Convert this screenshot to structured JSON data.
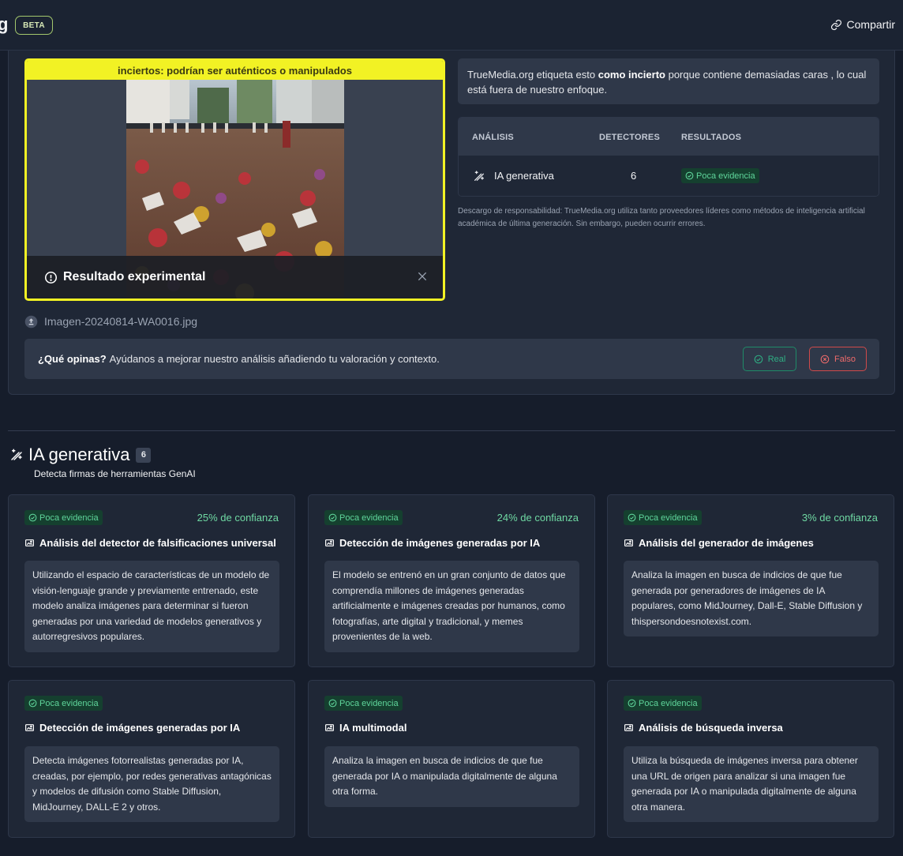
{
  "header": {
    "brand_char": "g",
    "beta": "BETA",
    "share": "Compartir"
  },
  "preview": {
    "banner": "inciertos: podrían ser auténticos o manipulados",
    "overlay_title": "Resultado experimental",
    "filename": "Imagen-20240814-WA0016.jpg"
  },
  "label_box": {
    "part1": "TrueMedia.org etiqueta esto ",
    "bold": "como incierto",
    "part2": " porque contiene demasiadas caras , lo cual está fuera de nuestro enfoque."
  },
  "analysis_table": {
    "headers": [
      "ANÁLISIS",
      "DETECTORES",
      "RESULTADOS"
    ],
    "rows": [
      {
        "name": "IA generativa",
        "detectors": "6",
        "result": "Poca evidencia"
      }
    ]
  },
  "disclaimer": "Descargo de responsabilidad: TrueMedia.org utiliza tanto proveedores líderes como métodos de inteligencia artificial académica de última generación. Sin embargo, pueden ocurrir errores.",
  "feedback": {
    "question": "¿Qué opinas?",
    "text": "Ayúdanos a mejorar nuestro análisis añadiendo tu valoración y contexto.",
    "real": "Real",
    "fake": "Falso"
  },
  "section": {
    "title": "IA generativa",
    "count": "6",
    "subtitle": "Detecta firmas de herramientas GenAI"
  },
  "detectors": [
    {
      "badge": "Poca evidencia",
      "confidence": "25% de confianza",
      "title": "Análisis del detector de falsificaciones universal",
      "desc": "Utilizando el espacio de características de un modelo de visión-lenguaje grande y previamente entrenado, este modelo analiza imágenes para determinar si fueron generadas por una variedad de modelos generativos y autorregresivos populares."
    },
    {
      "badge": "Poca evidencia",
      "confidence": "24% de confianza",
      "title": "Detección de imágenes generadas por IA",
      "desc": "El modelo se entrenó en un gran conjunto de datos que comprendía millones de imágenes generadas artificialmente e imágenes creadas por humanos, como fotografías, arte digital y tradicional, y memes provenientes de la web."
    },
    {
      "badge": "Poca evidencia",
      "confidence": "3% de confianza",
      "title": "Análisis del generador de imágenes",
      "desc": "Analiza la imagen en busca de indicios de que fue generada por generadores de imágenes de IA populares, como MidJourney, Dall-E, Stable Diffusion y thispersondoesnotexist.com."
    },
    {
      "badge": "Poca evidencia",
      "title": "Detección de imágenes generadas por IA",
      "desc": "Detecta imágenes fotorrealistas generadas por IA, creadas, por ejemplo, por redes generativas antagónicas y modelos de difusión como Stable Diffusion, MidJourney, DALL-E 2 y otros."
    },
    {
      "badge": "Poca evidencia",
      "title": "IA multimodal",
      "desc": "Analiza la imagen en busca de indicios de que fue generada por IA o manipulada digitalmente de alguna otra forma."
    },
    {
      "badge": "Poca evidencia",
      "title": "Análisis de búsqueda inversa",
      "desc": "Utiliza la búsqueda de imágenes inversa para obtener una URL de origen para analizar si una imagen fue generada por IA o manipulada digitalmente de alguna otra manera."
    }
  ]
}
